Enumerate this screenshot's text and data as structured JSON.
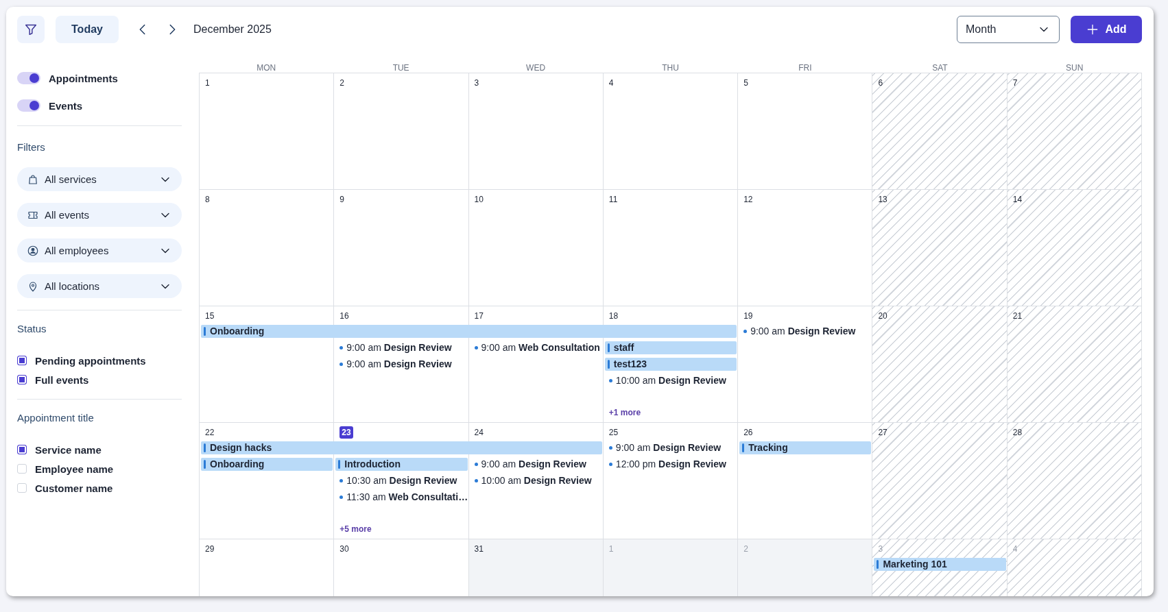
{
  "toolbar": {
    "today_button": "Today",
    "month_label": "December 2025",
    "view_select": {
      "value": "Month"
    },
    "add_button": "Add"
  },
  "sidebar": {
    "toggles": [
      {
        "label": "Appointments",
        "on": true
      },
      {
        "label": "Events",
        "on": true
      }
    ],
    "filters": {
      "heading": "Filters",
      "dropdowns": [
        {
          "value": "All services"
        },
        {
          "value": "All events"
        },
        {
          "value": "All employees"
        },
        {
          "value": "All locations"
        }
      ]
    },
    "status": {
      "heading": "Status",
      "options": [
        {
          "label": "Pending appointments",
          "checked": true
        },
        {
          "label": "Full events",
          "checked": true
        }
      ]
    },
    "appointment_title": {
      "heading": "Appointment title",
      "options": [
        {
          "label": "Service name",
          "checked": true
        },
        {
          "label": "Employee name",
          "checked": false
        },
        {
          "label": "Customer name",
          "checked": false
        }
      ]
    }
  },
  "calendar": {
    "weekdays": [
      "MON",
      "TUE",
      "WED",
      "THU",
      "FRI",
      "SAT",
      "SUN"
    ],
    "weeks": [
      {
        "days": [
          {
            "label": "1",
            "weekend": false,
            "other_month": false,
            "today": false,
            "shaded": false
          },
          {
            "label": "2",
            "weekend": false,
            "other_month": false,
            "today": false,
            "shaded": false
          },
          {
            "label": "3",
            "weekend": false,
            "other_month": false,
            "today": false,
            "shaded": false
          },
          {
            "label": "4",
            "weekend": false,
            "other_month": false,
            "today": false,
            "shaded": false
          },
          {
            "label": "5",
            "weekend": false,
            "other_month": false,
            "today": false,
            "shaded": false
          },
          {
            "label": "6",
            "weekend": true,
            "other_month": false,
            "today": false,
            "shaded": false
          },
          {
            "label": "7",
            "weekend": true,
            "other_month": false,
            "today": false,
            "shaded": false
          }
        ]
      },
      {
        "days": [
          {
            "label": "8",
            "weekend": false,
            "other_month": false,
            "today": false,
            "shaded": false
          },
          {
            "label": "9",
            "weekend": false,
            "other_month": false,
            "today": false,
            "shaded": false
          },
          {
            "label": "10",
            "weekend": false,
            "other_month": false,
            "today": false,
            "shaded": false
          },
          {
            "label": "11",
            "weekend": false,
            "other_month": false,
            "today": false,
            "shaded": false
          },
          {
            "label": "12",
            "weekend": false,
            "other_month": false,
            "today": false,
            "shaded": false
          },
          {
            "label": "13",
            "weekend": true,
            "other_month": false,
            "today": false,
            "shaded": false
          },
          {
            "label": "14",
            "weekend": true,
            "other_month": false,
            "today": false,
            "shaded": false
          }
        ]
      },
      {
        "days": [
          {
            "label": "15",
            "weekend": false,
            "other_month": false,
            "today": false,
            "shaded": false,
            "bars": [
              "Onboarding"
            ]
          },
          {
            "label": "16",
            "weekend": false,
            "other_month": false,
            "today": false,
            "shaded": false,
            "continues_bar": true,
            "items": [
              "9:00 am **Design Review**",
              "9:00 am **Design Review**"
            ]
          },
          {
            "label": "17",
            "weekend": false,
            "other_month": false,
            "today": false,
            "shaded": false,
            "continues_bar": true,
            "items": [
              "9:00 am **Web Consultation**"
            ]
          },
          {
            "label": "18",
            "weekend": false,
            "other_month": false,
            "today": false,
            "shaded": false,
            "continues_bar": true,
            "bars": [
              "staff",
              "test123"
            ],
            "items": [
              "10:00 am **Design Review**"
            ],
            "more": "+1 more"
          },
          {
            "label": "19",
            "weekend": false,
            "other_month": false,
            "today": false,
            "shaded": false,
            "continues_bar": false,
            "items": [
              "9:00 am **Design Review**"
            ]
          },
          {
            "label": "20",
            "weekend": true,
            "other_month": false,
            "today": false,
            "shaded": false
          },
          {
            "label": "21",
            "weekend": true,
            "other_month": false,
            "today": false,
            "shaded": false
          }
        ]
      },
      {
        "days": [
          {
            "label": "22",
            "weekend": false,
            "other_month": false,
            "today": false,
            "shaded": false,
            "bars": [
              "Design hacks",
              "Onboarding"
            ]
          },
          {
            "label": "23",
            "weekend": false,
            "other_month": false,
            "today": true,
            "shaded": false,
            "continues_bar": true,
            "bars": [
              "Introduction"
            ],
            "items": [
              "10:30 am **Design Review**",
              "11:30 am **Web Consultati…**"
            ],
            "more": "+5 more"
          },
          {
            "label": "24",
            "weekend": false,
            "other_month": false,
            "today": false,
            "shaded": false,
            "continues_bar": true,
            "items": [
              "9:00 am **Design Review**",
              "10:00 am **Design Review**"
            ]
          },
          {
            "label": "25",
            "weekend": false,
            "other_month": false,
            "today": false,
            "shaded": false,
            "items": [
              "9:00 am **Design Review**",
              "12:00 pm **Design Review**"
            ]
          },
          {
            "label": "26",
            "weekend": false,
            "other_month": false,
            "today": false,
            "shaded": false,
            "bars": [
              "Tracking"
            ]
          },
          {
            "label": "27",
            "weekend": true,
            "other_month": false,
            "today": false,
            "shaded": false,
            "continues_bar": false
          },
          {
            "label": "28",
            "weekend": true,
            "other_month": false,
            "today": false,
            "shaded": false
          }
        ]
      },
      {
        "days": [
          {
            "label": "29",
            "weekend": false,
            "other_month": false,
            "today": false,
            "shaded": false
          },
          {
            "label": "30",
            "weekend": false,
            "other_month": false,
            "today": false,
            "shaded": false
          },
          {
            "label": "31",
            "weekend": false,
            "other_month": false,
            "today": false,
            "shaded": true
          },
          {
            "label": "1",
            "weekend": false,
            "other_month": true,
            "today": false,
            "shaded": true
          },
          {
            "label": "2",
            "weekend": false,
            "other_month": true,
            "today": false,
            "shaded": true
          },
          {
            "label": "3",
            "weekend": true,
            "other_month": true,
            "today": false,
            "shaded": false,
            "bars": [
              "Marketing 101"
            ]
          },
          {
            "label": "4",
            "weekend": true,
            "other_month": true,
            "today": false,
            "shaded": false,
            "continues_bar": false
          }
        ]
      }
    ]
  }
}
